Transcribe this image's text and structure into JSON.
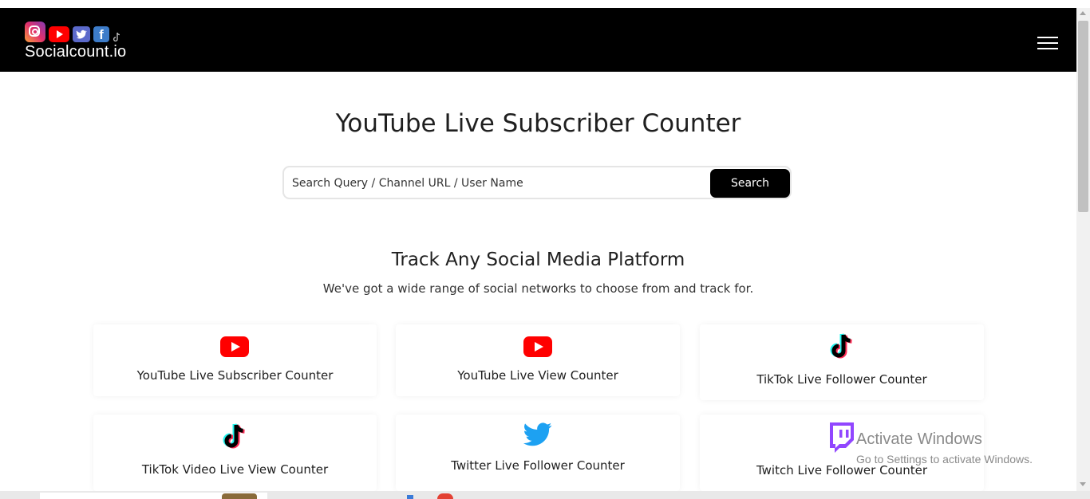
{
  "brand": {
    "name": "Socialcount.io"
  },
  "header": {
    "menu_icon": "hamburger-menu-icon"
  },
  "hero": {
    "title": "YouTube Live Subscriber Counter",
    "search_placeholder": "Search Query / Channel URL / User Name",
    "search_button": "Search"
  },
  "platforms": {
    "title": "Track Any Social Media Platform",
    "subtitle": "We've got a wide range of social networks to choose from and track for.",
    "cards": [
      {
        "label": "YouTube Live Subscriber Counter",
        "icon": "youtube-icon"
      },
      {
        "label": "YouTube Live View Counter",
        "icon": "youtube-icon"
      },
      {
        "label": "TikTok Live Follower Counter",
        "icon": "tiktok-icon"
      },
      {
        "label": "TikTok Video Live View Counter",
        "icon": "tiktok-icon"
      },
      {
        "label": "Twitter Live Follower Counter",
        "icon": "twitter-icon"
      },
      {
        "label": "Twitch Live Follower Counter",
        "icon": "twitch-icon"
      }
    ]
  },
  "os_watermark": {
    "title": "Activate Windows",
    "subtitle": "Go to Settings to activate Windows."
  },
  "colors": {
    "navbar": "#000000",
    "youtube": "#ff0000",
    "twitter": "#1da1f2",
    "twitch": "#9146ff",
    "search_button": "#000000"
  }
}
